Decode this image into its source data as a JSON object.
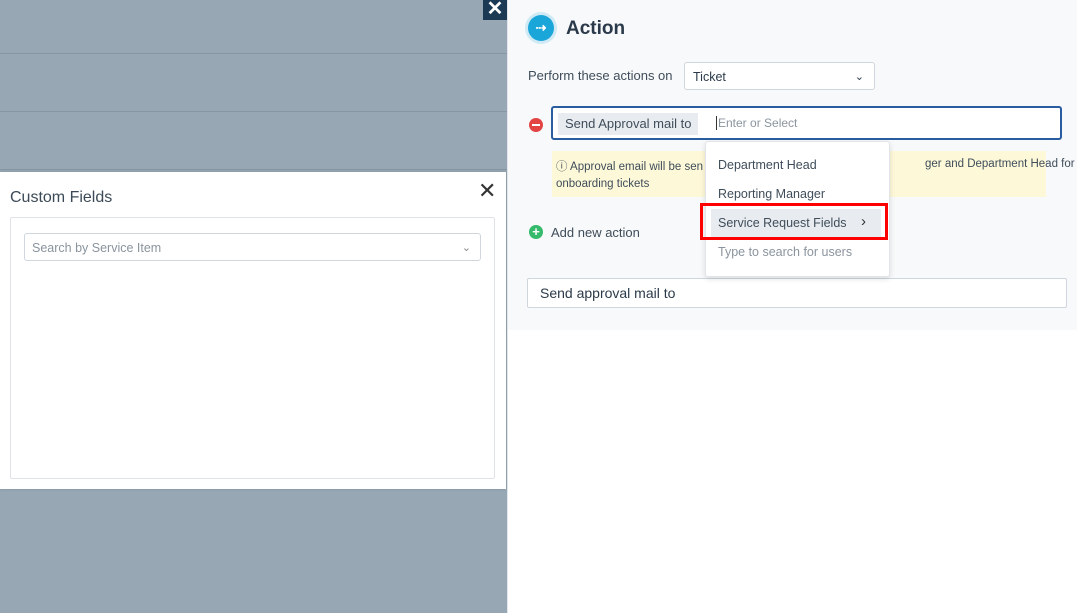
{
  "overlay": {
    "close_icon": "✕"
  },
  "custom_fields": {
    "title": "Custom Fields",
    "close_icon": "✕",
    "search_placeholder": "Search by Service Item",
    "chevron_icon": "⌄"
  },
  "action": {
    "title": "Action",
    "icon": "⇢",
    "perform_label": "Perform these actions on",
    "entity_value": "Ticket",
    "chevron_icon": "⌄",
    "approval_tag": "Send Approval mail to",
    "approval_placeholder": "Enter or Select",
    "info_line1_left": "ⓘ Approval email will be sen",
    "info_line1_right": "ger and Department Head for",
    "info_line2": "onboarding tickets",
    "add_icon": "+",
    "add_label": "Add new action",
    "mail_subject": "Send approval mail to"
  },
  "dropdown": {
    "items": [
      "Department Head",
      "Reporting Manager",
      "Service Request Fields",
      "Type to search for users"
    ],
    "arrow_icon": "›"
  },
  "colors": {
    "accent": "#1aa6d8",
    "remove": "#e34545",
    "add": "#35b96a",
    "highlight_border": "#ff0000"
  }
}
